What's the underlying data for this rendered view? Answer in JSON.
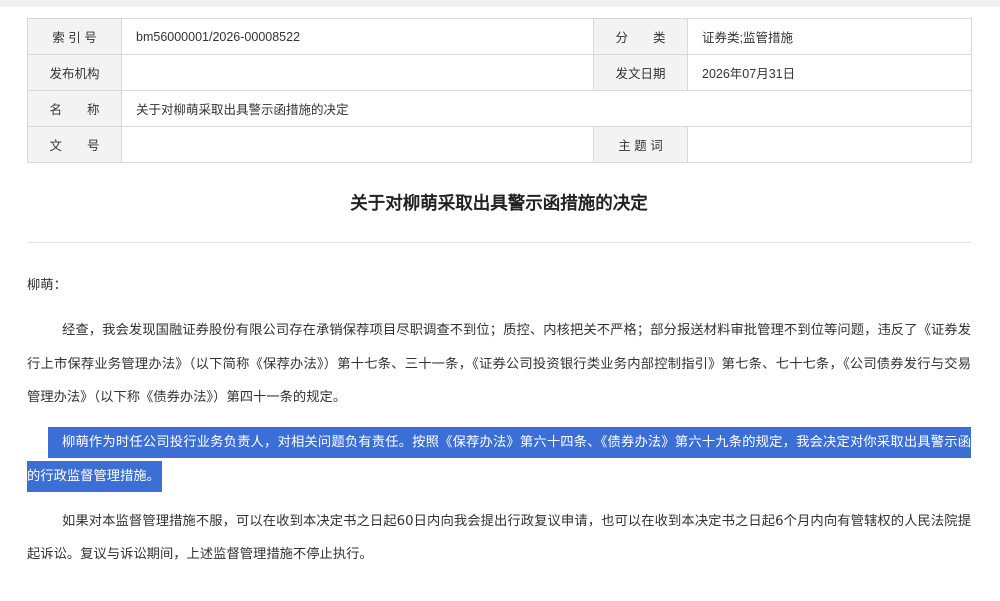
{
  "colors": {
    "selection_bg": "#3b6fd6",
    "selection_text": "#ffffff",
    "label_bg": "#f3f3f3",
    "border": "#d8d8d8"
  },
  "info_table": {
    "index_label": "索 引 号",
    "index_value": "bm56000001/2026-00008522",
    "category_label": "分　　类",
    "category_value": "证券类;监管措施",
    "publisher_label": "发布机构",
    "date_label": "发文日期",
    "date_value": "2026年07月31日",
    "name_label": "名　　称",
    "name_value": "关于对柳萌采取出具警示函措施的决定",
    "doc_number_label": "文　　号",
    "keywords_label": "主 题 词"
  },
  "article": {
    "title": "关于对柳萌采取出具警示函措施的决定",
    "salutation": "柳萌：",
    "paragraphs": [
      "经查，我会发现国融证券股份有限公司存在承销保荐项目尽职调查不到位；质控、内核把关不严格；部分报送材料审批管理不到位等问题，违反了《证券发行上市保荐业务管理办法》（以下简称《保荐办法》）第十七条、三十一条，《证券公司投资银行类业务内部控制指引》第七条、七十七条，《公司债券发行与交易管理办法》（以下称《债券办法》）第四十一条的规定。",
      "柳萌作为时任公司投行业务负责人，对相关问题负有责任。按照《保荐办法》第六十四条、《债券办法》第六十九条的规定，我会决定对你采取出具警示函的行政监督管理措施。",
      "如果对本监督管理措施不服，可以在收到本决定书之日起60日内向我会提出行政复议申请，也可以在收到本决定书之日起6个月内向有管辖权的人民法院提起诉讼。复议与诉讼期间，上述监督管理措施不停止执行。"
    ]
  }
}
